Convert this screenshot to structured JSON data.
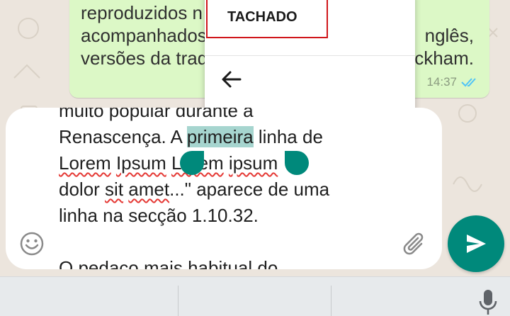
{
  "colors": {
    "accent": "#00897b",
    "bubble_background": "#dcf8c6",
    "menu_highlight_border": "#d0161b",
    "selection_highlight": "#a6d5cf",
    "spellcheck_underline": "#e53935"
  },
  "message": {
    "lines": [
      "reproduzidos n",
      "acompanhados",
      "versões da trad"
    ],
    "tail_right": [
      "nglês,",
      "ckham."
    ],
    "time": "14:37",
    "status_icon": "double-check-icon"
  },
  "context_menu": {
    "item_label": "TACHADO",
    "back_icon": "arrow-left-icon"
  },
  "composer": {
    "line0": "muito popular durante a",
    "line1_pre": "Renascença. A ",
    "line1_sel": "primeira",
    "line1_post": " linha de",
    "line2_w1": "Lorem",
    "line2_w2": "Ipsum",
    "line2_w3": "Lorem",
    "line2_w4": "ipsum",
    "line3_w1": "dolor ",
    "line3_w2": "sit",
    "line3_w3": "amet",
    "line3_w4": "...\" aparece de uma",
    "line4": "linha na secção 1.10.32.",
    "line6": "O pedaço mais habitual do",
    "emoji_icon": "smiley-icon",
    "attach_icon": "paperclip-icon"
  },
  "send_icon": "send-icon",
  "keyboard": {
    "mic_icon": "microphone-icon"
  }
}
